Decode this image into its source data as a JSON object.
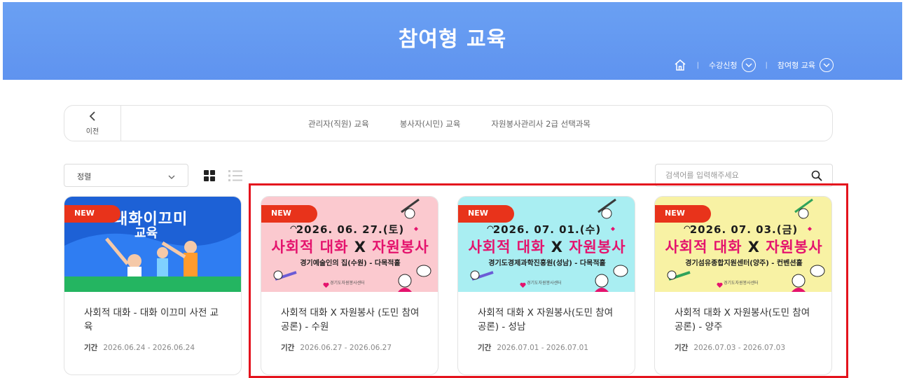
{
  "header": {
    "title": "참여형 교육",
    "breadcrumb": [
      {
        "label": "수강신청"
      },
      {
        "label": "참여형 교육"
      }
    ]
  },
  "subnav": {
    "back_label": "이전",
    "links": [
      "관리자(직원) 교육",
      "봉사자(시민) 교육",
      "자원봉사관리사 2급 선택과목"
    ]
  },
  "toolbar": {
    "sort_label": "정렬",
    "search_placeholder": "검색어를 입력해주세요"
  },
  "cards": [
    {
      "badge": "NEW",
      "title": "사회적 대화 - 대화 이끄미 사전 교육",
      "period_label": "기간",
      "period": "2026.06.24 - 2026.06.24",
      "poster": {
        "line1": "대화이끄미",
        "line2": "교육"
      }
    },
    {
      "badge": "NEW",
      "title": "사회적 대화 X 자원봉사 (도민 참여 공론) - 수원",
      "period_label": "기간",
      "period": "2026.06.27 - 2026.06.27",
      "poster": {
        "date": "2026. 06. 27.(토)",
        "main_a": "사회적 대화",
        "x": "X",
        "main_b": "자원봉사",
        "venue": "경기예술인의 집(수원) - 다목적홀",
        "org": "경기도자원봉사센터",
        "bg": "#fbc9cf"
      }
    },
    {
      "badge": "NEW",
      "title": "사회적 대화 X 자원봉사(도민 참여 공론) - 성남",
      "period_label": "기간",
      "period": "2026.07.01 - 2026.07.01",
      "poster": {
        "date": "2026. 07. 01.(수)",
        "main_a": "사회적 대화",
        "x": "X",
        "main_b": "자원봉사",
        "venue": "경기도경제과학진흥원(성남) - 다목적홀",
        "org": "경기도자원봉사센터",
        "bg": "#a9eef2"
      }
    },
    {
      "badge": "NEW",
      "title": "사회적 대화 X 자원봉사(도민 참여 공론) - 양주",
      "period_label": "기간",
      "period": "2026.07.03 - 2026.07.03",
      "poster": {
        "date": "2026. 07. 03.(금)",
        "main_a": "사회적 대화",
        "x": "X",
        "main_b": "자원봉사",
        "venue": "경기섬유종합지원센터(양주) - 컨벤션홀",
        "org": "경기도자원봉사센터",
        "bg": "#f8f2a4"
      }
    }
  ]
}
